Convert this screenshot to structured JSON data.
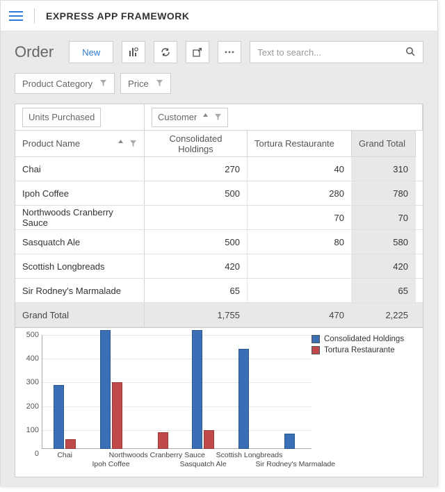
{
  "app": {
    "title": "EXPRESS APP FRAMEWORK"
  },
  "page": {
    "title": "Order"
  },
  "actions": {
    "new": "New"
  },
  "search": {
    "placeholder": "Text to search..."
  },
  "filters": {
    "category": "Product Category",
    "price": "Price"
  },
  "pivot": {
    "row_area_label": "Units Purchased",
    "row_field": "Product Name",
    "col_field": "Customer",
    "columns": [
      "Consolidated Holdings",
      "Tortura Restaurante",
      "Grand Total"
    ],
    "rows": [
      {
        "product": "Chai",
        "v": [
          "270",
          "40",
          "310"
        ]
      },
      {
        "product": "Ipoh Coffee",
        "v": [
          "500",
          "280",
          "780"
        ]
      },
      {
        "product": "Northwoods Cranberry Sauce",
        "v": [
          "",
          "70",
          "70"
        ]
      },
      {
        "product": "Sasquatch Ale",
        "v": [
          "500",
          "80",
          "580"
        ]
      },
      {
        "product": "Scottish Longbreads",
        "v": [
          "420",
          "",
          "420"
        ]
      },
      {
        "product": "Sir Rodney's Marmalade",
        "v": [
          "65",
          "",
          "65"
        ]
      }
    ],
    "total": {
      "label": "Grand Total",
      "v": [
        "1,755",
        "470",
        "2,225"
      ]
    }
  },
  "chart_data": {
    "type": "bar",
    "categories": [
      "Chai",
      "Ipoh Coffee",
      "Northwoods Cranberry Sauce",
      "Sasquatch Ale",
      "Scottish Longbreads",
      "Sir Rodney's Marmalade"
    ],
    "series": [
      {
        "name": "Consolidated Holdings",
        "values": [
          270,
          500,
          0,
          500,
          420,
          65
        ]
      },
      {
        "name": "Tortura Restaurante",
        "values": [
          40,
          280,
          70,
          80,
          0,
          0
        ]
      }
    ],
    "yticks": [
      0,
      100,
      200,
      300,
      400,
      500
    ],
    "ylim": [
      0,
      500
    ],
    "xlabel": "",
    "ylabel": "",
    "title": ""
  }
}
